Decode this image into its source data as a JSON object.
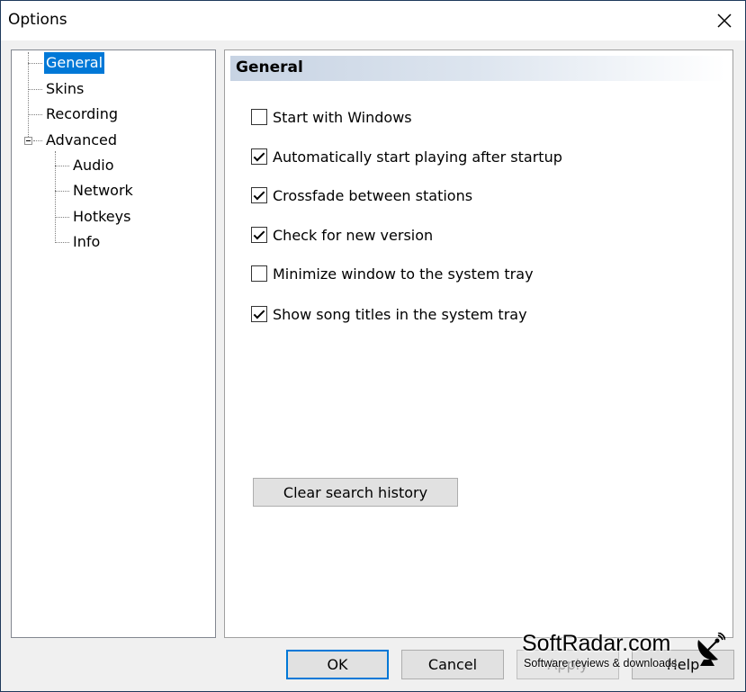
{
  "window": {
    "title": "Options"
  },
  "tree": {
    "items": [
      {
        "label": "General",
        "selected": true
      },
      {
        "label": "Skins"
      },
      {
        "label": "Recording"
      },
      {
        "label": "Advanced",
        "expanded": true
      },
      {
        "label": "Audio"
      },
      {
        "label": "Network"
      },
      {
        "label": "Hotkeys"
      },
      {
        "label": "Info"
      }
    ]
  },
  "panel": {
    "title": "General",
    "options": [
      {
        "label": "Start with Windows",
        "checked": false
      },
      {
        "label": "Automatically start playing after startup",
        "checked": true
      },
      {
        "label": "Crossfade between stations",
        "checked": true
      },
      {
        "label": "Check for new version",
        "checked": true
      },
      {
        "label": "Minimize window to the system tray",
        "checked": false
      },
      {
        "label": "Show song titles in the system tray",
        "checked": true
      }
    ],
    "clear_button": "Clear search history"
  },
  "buttons": {
    "ok": "OK",
    "cancel": "Cancel",
    "apply": "Apply",
    "help": "Help"
  },
  "watermark": {
    "brand": "SoftRadar.com",
    "tagline": "Software reviews & downloads"
  },
  "colors": {
    "selection": "#0078d7",
    "default_button_border": "#0078d7",
    "header_gradient_start": "#c7d3e3"
  }
}
